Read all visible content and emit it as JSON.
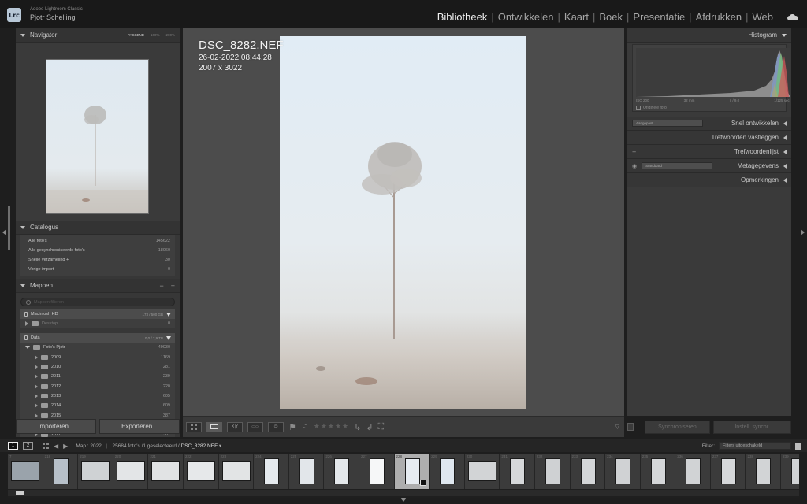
{
  "app": {
    "logo_text": "Lrc",
    "name": "Adobe Lightroom Classic",
    "user": "Pjotr Schelling"
  },
  "modules": [
    {
      "label": "Bibliotheek",
      "active": true
    },
    {
      "label": "Ontwikkelen",
      "active": false
    },
    {
      "label": "Kaart",
      "active": false
    },
    {
      "label": "Boek",
      "active": false
    },
    {
      "label": "Presentatie",
      "active": false
    },
    {
      "label": "Afdrukken",
      "active": false
    },
    {
      "label": "Web",
      "active": false
    }
  ],
  "navigator": {
    "title": "Navigator",
    "zoom_fit": "PASSEND",
    "zoom_100": "100%",
    "zoom_200": "200%"
  },
  "catalog": {
    "title": "Catalogus",
    "items": [
      {
        "label": "Alle foto's",
        "count": "145622"
      },
      {
        "label": "Alle gesynchroniseerde foto's",
        "count": "18060"
      },
      {
        "label": "Snelle verzameling +",
        "count": "30"
      },
      {
        "label": "Vorige import",
        "count": "0"
      }
    ]
  },
  "folders": {
    "title": "Mappen",
    "search_placeholder": "Mappen filteren",
    "volumes": [
      {
        "name": "Macintosh HD",
        "info": "173 / 500 GB"
      },
      {
        "name": "Data",
        "info": "0,0 / 7,9 TB"
      }
    ],
    "desktop": {
      "label": "Desktop",
      "count": "0"
    },
    "root": {
      "label": "Foto's Pjotr",
      "count": "49930"
    },
    "years": [
      {
        "label": "2009",
        "count": "1169"
      },
      {
        "label": "2010",
        "count": "281"
      },
      {
        "label": "2011",
        "count": "239"
      },
      {
        "label": "2012",
        "count": "220"
      },
      {
        "label": "2013",
        "count": "605"
      },
      {
        "label": "2014",
        "count": "609"
      },
      {
        "label": "2015",
        "count": "387"
      },
      {
        "label": "2016",
        "count": "222"
      },
      {
        "label": "2017",
        "count": "387"
      }
    ]
  },
  "buttons": {
    "import": "Importeren...",
    "export": "Exporteren..."
  },
  "photo": {
    "filename": "DSC_8282.NEF",
    "datetime": "26-02-2022 08:44:28",
    "dimensions": "2007 x 3022"
  },
  "histogram": {
    "title": "Histogram",
    "iso": "ISO 200",
    "focal": "32 mm",
    "aperture": "ƒ / 9,0",
    "shutter": "1/125 sec.",
    "original_label": "Originele foto"
  },
  "right_sections": {
    "preset_dropdown": "Aangepast",
    "quick_develop": "Snel ontwikkelen",
    "keywording": "Trefwoorden vastleggen",
    "keyword_list": "Trefwoordenlijst",
    "metadata_dropdown": "Standaard",
    "metadata": "Metagegevens",
    "comments": "Opmerkingen"
  },
  "sync": {
    "sync_label": "Synchroniseren",
    "settings_label": "Instell. synchr."
  },
  "filmstrip_bar": {
    "screen1": "1",
    "screen2": "2",
    "source": "Map : 2022",
    "count_text": "25684 foto's /1 geselecteerd /",
    "selected_file": "DSC_8282.NEF",
    "filter_label": "Filter:",
    "filter_value": "Filters uitgeschakeld"
  },
  "filmstrip": [
    {
      "n": "7",
      "type": "land",
      "bg": "#9aa3ab"
    },
    {
      "n": "218",
      "type": "port",
      "bg": "#b7c0c9"
    },
    {
      "n": "219",
      "type": "land",
      "bg": "#cfd2d4"
    },
    {
      "n": "220",
      "type": "land",
      "bg": "#e3e5e7"
    },
    {
      "n": "221",
      "type": "land",
      "bg": "#e1e3e4"
    },
    {
      "n": "222",
      "type": "land",
      "bg": "#e6e8ea"
    },
    {
      "n": "223",
      "type": "land",
      "bg": "#e2e4e5"
    },
    {
      "n": "224",
      "type": "port",
      "bg": "#e5eaee"
    },
    {
      "n": "225",
      "type": "port",
      "bg": "#e2e6ea"
    },
    {
      "n": "226",
      "type": "port",
      "bg": "#e4e8eb"
    },
    {
      "n": "227",
      "type": "port",
      "bg": "#f6f7f8"
    },
    {
      "n": "228",
      "type": "port",
      "bg": "#e7ecf1",
      "selected": true
    },
    {
      "n": "229",
      "type": "port",
      "bg": "#dfe7ef"
    },
    {
      "n": "230",
      "type": "land",
      "bg": "#d2d4d6"
    },
    {
      "n": "231",
      "type": "port",
      "bg": "#d6d8da"
    },
    {
      "n": "232",
      "type": "port",
      "bg": "#cfd1d3"
    },
    {
      "n": "233",
      "type": "port",
      "bg": "#d3d5d7"
    },
    {
      "n": "234",
      "type": "port",
      "bg": "#d0d2d4"
    },
    {
      "n": "235",
      "type": "port",
      "bg": "#d4d6d8"
    },
    {
      "n": "236",
      "type": "port",
      "bg": "#d1d3d5"
    },
    {
      "n": "237",
      "type": "port",
      "bg": "#d5d7d9"
    },
    {
      "n": "238",
      "type": "port",
      "bg": "#d2d4d6"
    },
    {
      "n": "239",
      "type": "port",
      "bg": "#d0d2d4"
    }
  ],
  "colors": {
    "app_bg": "#1e1e1e",
    "panel_bg": "#373737",
    "center_bg": "#4c4c4c",
    "active_module": "#f0f0f0"
  }
}
